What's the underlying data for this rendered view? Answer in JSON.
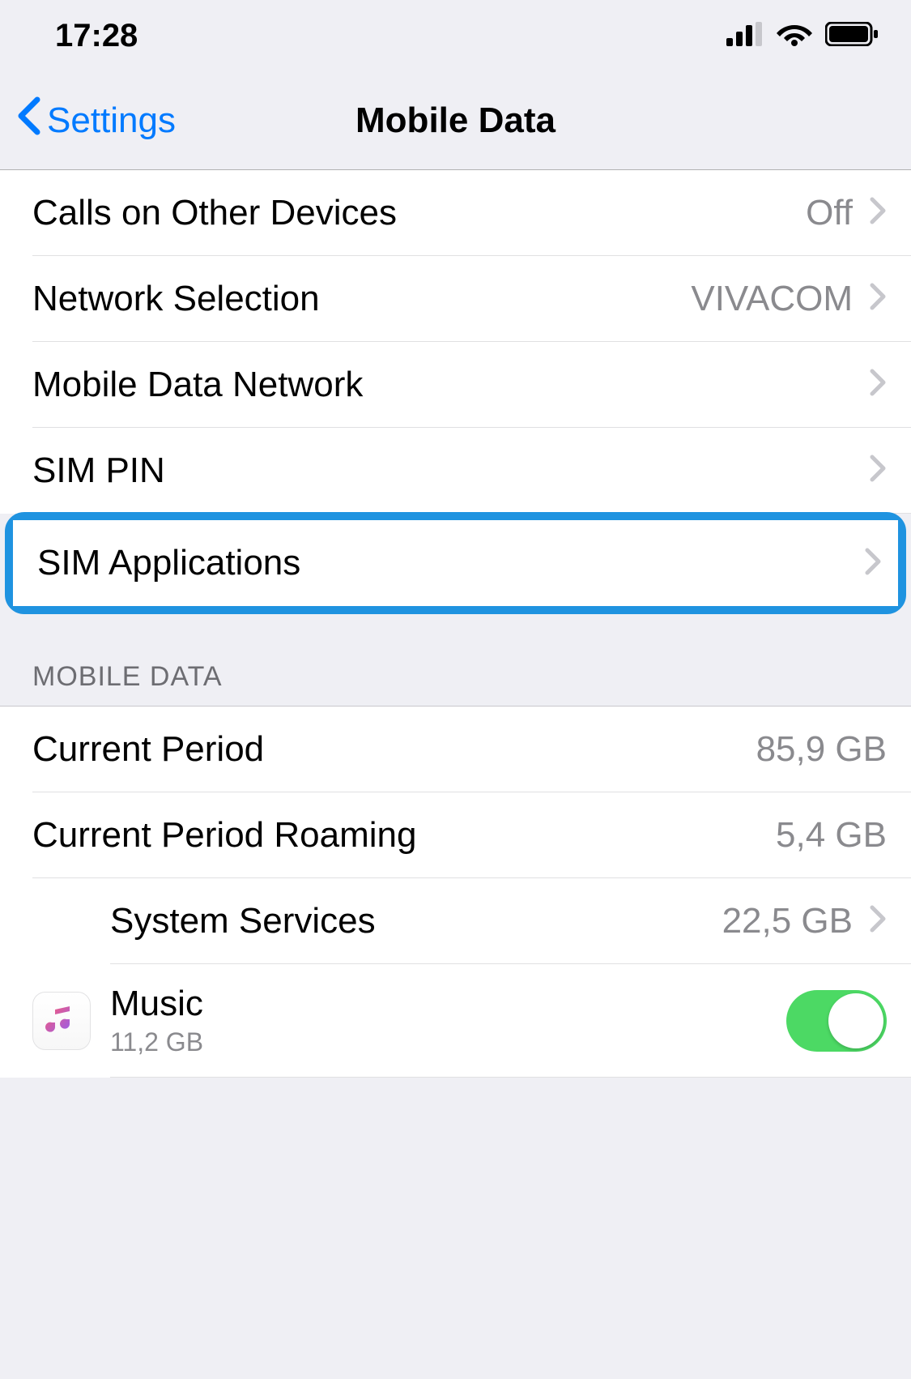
{
  "status_bar": {
    "time": "17:28"
  },
  "nav": {
    "back_label": "Settings",
    "title": "Mobile Data"
  },
  "section1": {
    "rows": [
      {
        "label": "Calls on Other Devices",
        "value": "Off"
      },
      {
        "label": "Network Selection",
        "value": "VIVACOM"
      },
      {
        "label": "Mobile Data Network",
        "value": ""
      },
      {
        "label": "SIM PIN",
        "value": ""
      },
      {
        "label": "SIM Applications",
        "value": ""
      }
    ]
  },
  "section2": {
    "header": "MOBILE DATA",
    "rows": [
      {
        "label": "Current Period",
        "value": "85,9 GB"
      },
      {
        "label": "Current Period Roaming",
        "value": "5,4 GB"
      },
      {
        "label": "System Services",
        "value": "22,5 GB"
      }
    ],
    "app": {
      "name": "Music",
      "usage": "11,2 GB",
      "toggle": true
    }
  }
}
